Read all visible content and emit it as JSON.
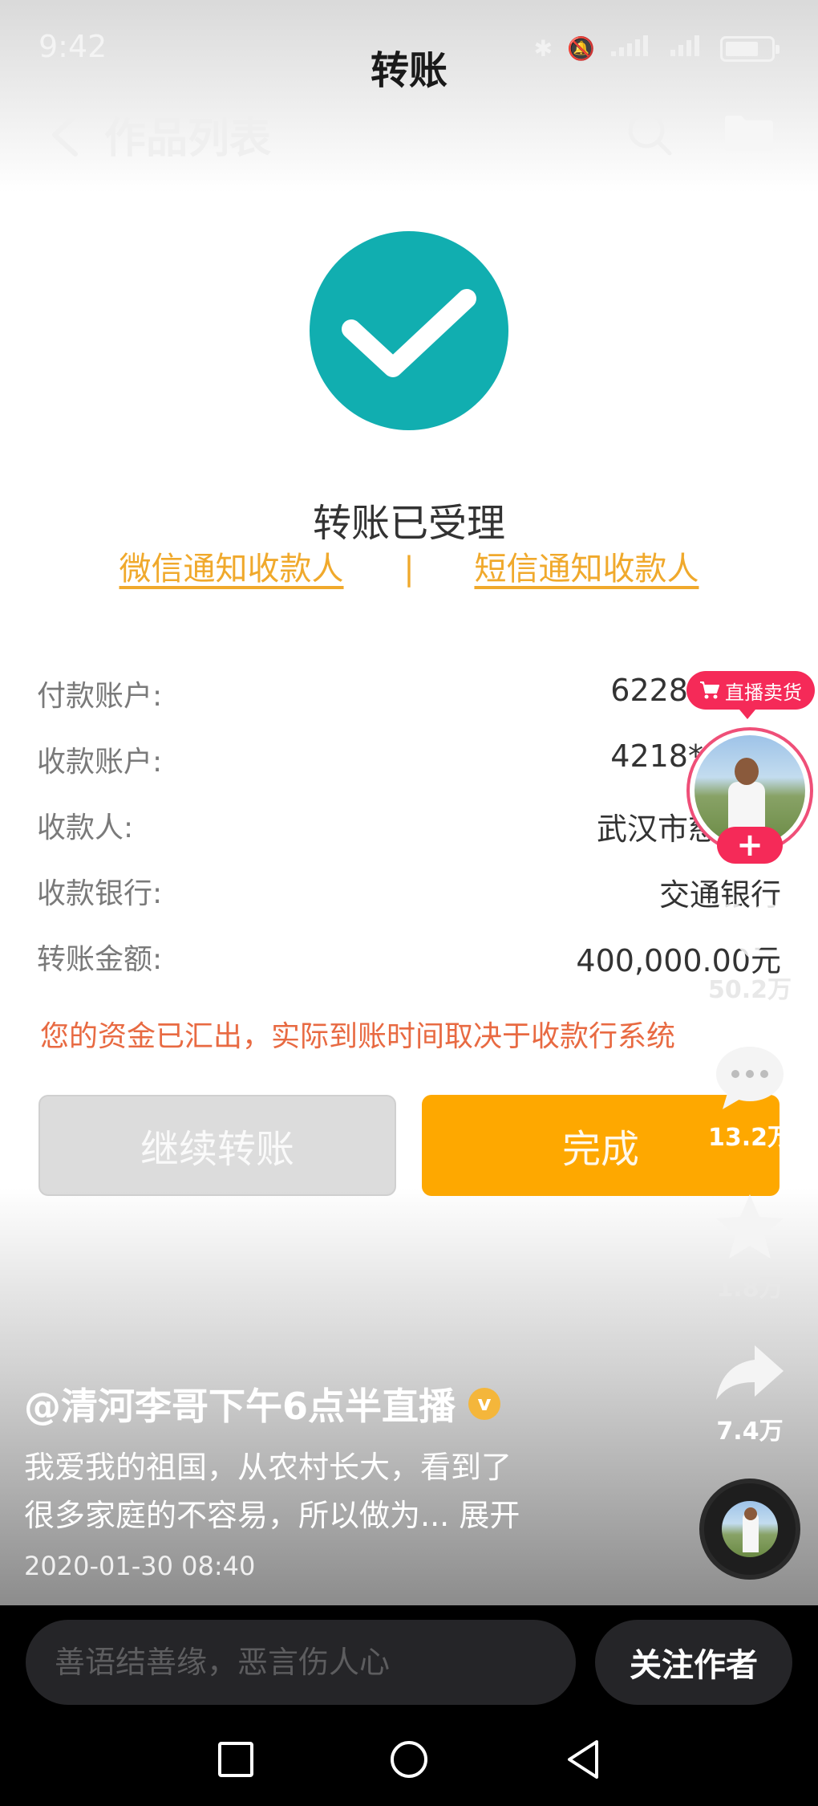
{
  "status_bar": {
    "time": "9:42"
  },
  "transfer_page": {
    "title": "转账",
    "success_title": "转账已受理",
    "notify_wechat": "微信通知收款人",
    "notify_separator": "|",
    "notify_sms": "短信通知收款人",
    "details": [
      {
        "label": "付款账户:",
        "value": "6228****"
      },
      {
        "label": "收款账户:",
        "value": "4218****"
      },
      {
        "label": "收款人:",
        "value": "武汉市慈善"
      },
      {
        "label": "收款银行:",
        "value": "交通银行"
      },
      {
        "label": "转账金额:",
        "value": "400,000.00元"
      }
    ],
    "notice": "您的资金已汇出，实际到账时间取决于收款行系统",
    "continue_button": "继续转账",
    "done_button": "完成"
  },
  "app_nav": {
    "title": "作品列表"
  },
  "side_actions": {
    "live_badge": "直播卖货",
    "follow_plus": "+",
    "likes": "50.2万",
    "comments": "13.2万",
    "favorites": "1.8万",
    "shares": "7.4万"
  },
  "caption": {
    "author": "@清河李哥下午6点半直播",
    "verified": "v",
    "description_line1": "我爱我的祖国，从农村长大，看到了",
    "description_line2": "很多家庭的不容易，所以做为... 展开",
    "timestamp": "2020-01-30 08:40"
  },
  "bottom_bar": {
    "comment_placeholder": "善语结善缘，恶言伤人心",
    "follow_author": "关注作者"
  },
  "colors": {
    "success_teal": "#11aeb0",
    "done_orange": "#fea800",
    "link_orange": "#f0a92c",
    "notice_red": "#e86a42",
    "douyin_pink": "#f52a58"
  }
}
